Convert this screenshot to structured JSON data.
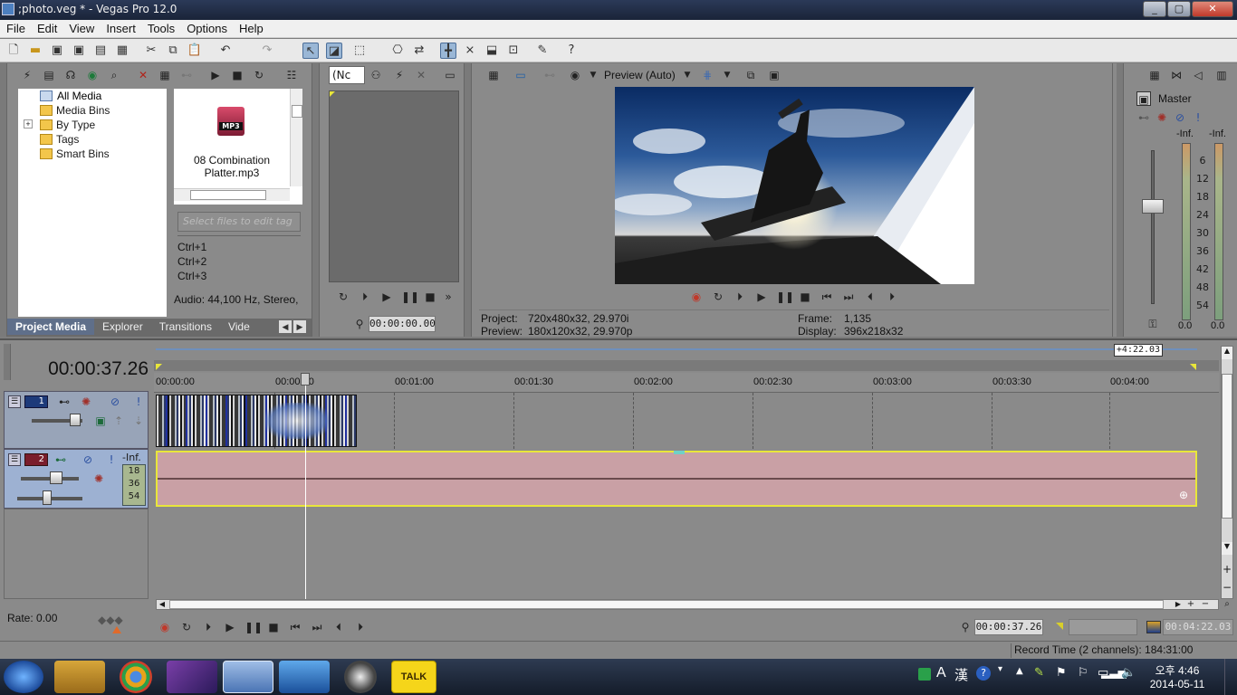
{
  "window": {
    "title": ";photo.veg * - Vegas Pro 12.0",
    "min": "_",
    "max": "▢",
    "close": "✕"
  },
  "menu": [
    "File",
    "Edit",
    "View",
    "Insert",
    "Tools",
    "Options",
    "Help"
  ],
  "project_media": {
    "tree": [
      "All Media",
      "Media Bins",
      "By Type",
      "Tags",
      "Smart Bins"
    ],
    "expand_symbol": "+",
    "file_name": "08 Combination Platter.mp3",
    "file_badge": "MP3",
    "tag_placeholder": "Select files to edit tag",
    "shortcuts": [
      "Ctrl+1",
      "Ctrl+2",
      "Ctrl+3"
    ],
    "audio_info": "Audio: 44,100 Hz, Stereo,",
    "tabs": [
      "Project Media",
      "Explorer",
      "Transitions",
      "Vide"
    ]
  },
  "trimmer": {
    "dropdown": "(Nc",
    "timecode": "00:00:00.00"
  },
  "preview": {
    "quality": "Preview (Auto)",
    "project_label": "Project:",
    "project_value": "720x480x32, 29.970i",
    "preview_label": "Preview:",
    "preview_value": "180x120x32, 29.970p",
    "frame_label": "Frame:",
    "frame_value": "1,135",
    "display_label": "Display:",
    "display_value": "396x218x32"
  },
  "master": {
    "title": "Master",
    "left_peak": "-Inf.",
    "right_peak": "-Inf.",
    "scale": [
      "6",
      "12",
      "18",
      "24",
      "30",
      "36",
      "42",
      "48",
      "54"
    ],
    "left_val": "0.0",
    "right_val": "0.0"
  },
  "timeline": {
    "current_time": "00:00:37.26",
    "region_length": "+4:22.03",
    "ruler": [
      "00:00:00",
      "00:00:30",
      "00:01:00",
      "00:01:30",
      "00:02:00",
      "00:02:30",
      "00:03:00",
      "00:03:30",
      "00:04:00"
    ],
    "track1_number": "1",
    "track2_number": "2",
    "track2_peak": "-Inf.",
    "track2_scale": [
      "18",
      "36",
      "54"
    ],
    "rate": "Rate: 0.00",
    "cursor_time": "00:00:37.26",
    "end_time": "00:04:22.03",
    "record_time": "Record Time (2 channels): 184:31:00"
  },
  "taskbar": {
    "time": "오후 4:46",
    "date": "2014-05-11",
    "ime_a": "A",
    "ime_han": "漢",
    "talk": "TALK"
  },
  "colors": {
    "audio_event": "#c9a0a5",
    "audio_border": "#e8e63a",
    "playhead": "#ffffff",
    "selection_blue": "#5f6f8a"
  }
}
